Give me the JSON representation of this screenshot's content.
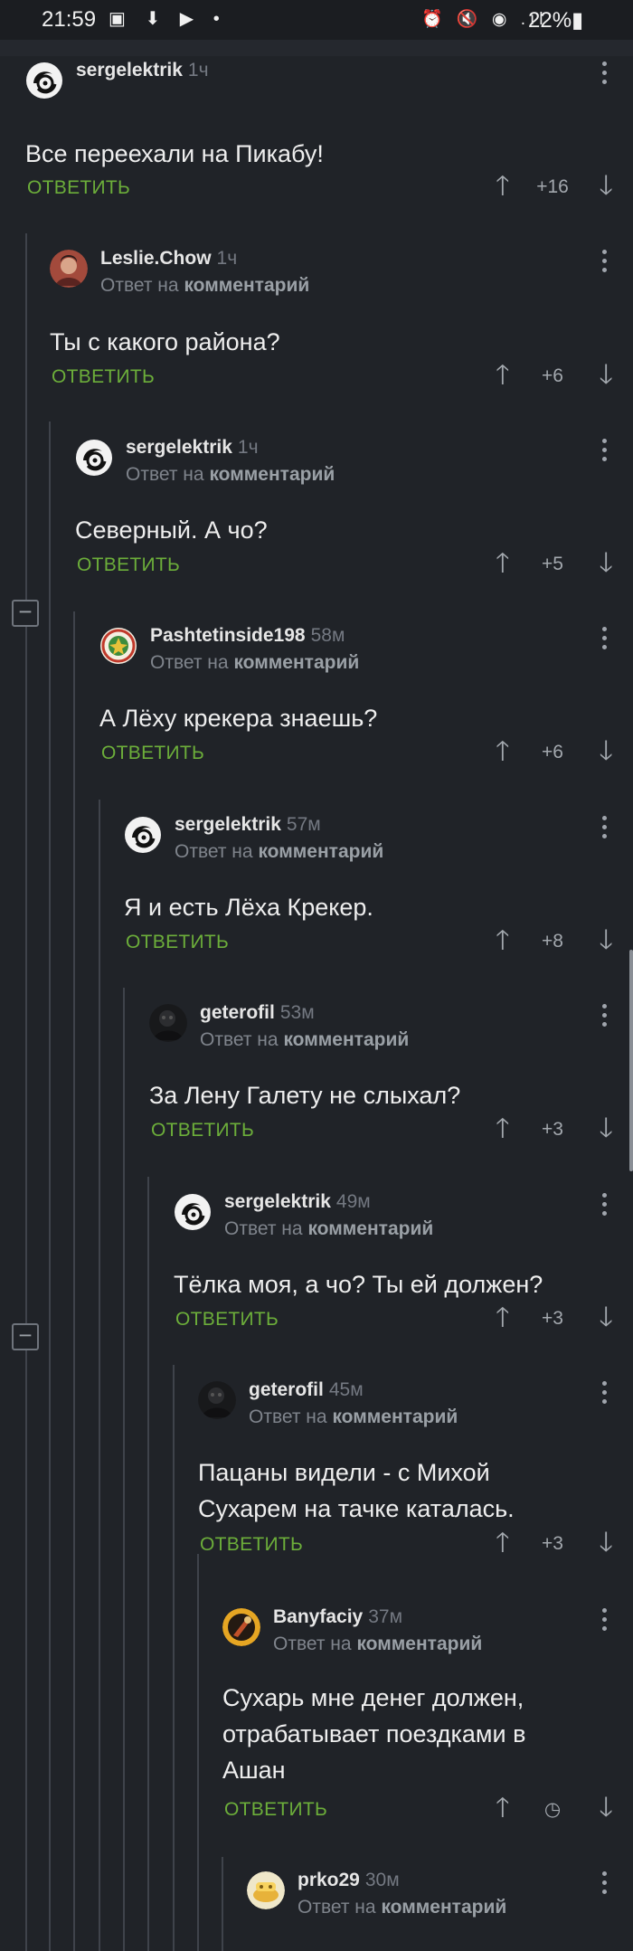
{
  "status_bar": {
    "time": "21:59",
    "left_icons": "▣ ⬇ ▶ •",
    "right_icons": "⏰ 🔇 ◉ .ıl",
    "battery": "22%▮"
  },
  "comments": [
    {
      "author": "sergelektrik",
      "time": "1ч",
      "reply_prefix": "",
      "reply_target": "",
      "text": "Все переехали на Пикабу!",
      "reply_label": "ОТВЕТИТЬ",
      "score": "+16",
      "avatar": "logo"
    },
    {
      "author": "Leslie.Chow",
      "time": "1ч",
      "reply_prefix": "Ответ на",
      "reply_target": "комментарий",
      "text": "Ты с какого района?",
      "reply_label": "ОТВЕТИТЬ",
      "score": "+6",
      "avatar": "photo-red"
    },
    {
      "author": "sergelektrik",
      "time": "1ч",
      "reply_prefix": "Ответ на",
      "reply_target": "комментарий",
      "text": "Северный. А чо?",
      "reply_label": "ОТВЕТИТЬ",
      "score": "+5",
      "avatar": "logo"
    },
    {
      "author": "Pashtetinside198",
      "time": "58м",
      "reply_prefix": "Ответ на",
      "reply_target": "комментарий",
      "text": "А Лёху крекера знаешь?",
      "reply_label": "ОТВЕТИТЬ",
      "score": "+6",
      "avatar": "emblem"
    },
    {
      "author": "sergelektrik",
      "time": "57м",
      "reply_prefix": "Ответ на",
      "reply_target": "комментарий",
      "text": "Я и есть Лёха Крекер.",
      "reply_label": "ОТВЕТИТЬ",
      "score": "+8",
      "avatar": "logo"
    },
    {
      "author": "geterofil",
      "time": "53м",
      "reply_prefix": "Ответ на",
      "reply_target": "комментарий",
      "text": "За Лену Галету не слыхал?",
      "reply_label": "ОТВЕТИТЬ",
      "score": "+3",
      "avatar": "photo-dark"
    },
    {
      "author": "sergelektrik",
      "time": "49м",
      "reply_prefix": "Ответ на",
      "reply_target": "комментарий",
      "text": "Тёлка моя, а чо? Ты ей должен?",
      "reply_label": "ОТВЕТИТЬ",
      "score": "+3",
      "avatar": "logo"
    },
    {
      "author": "geterofil",
      "time": "45м",
      "reply_prefix": "Ответ на",
      "reply_target": "комментарий",
      "text": "Пацаны видели - с Михой\nСухарем на тачке каталась.",
      "reply_label": "ОТВЕТИТЬ",
      "score": "+3",
      "avatar": "photo-dark"
    },
    {
      "author": "Banyfaciy",
      "time": "37м",
      "reply_prefix": "Ответ на",
      "reply_target": "комментарий",
      "text": "Сухарь мне денег должен,\nотрабатывает поездками в\nАшан",
      "reply_label": "ОТВЕТИТЬ",
      "score": "",
      "avatar": "photo-orange"
    },
    {
      "author": "prko29",
      "time": "30м",
      "reply_prefix": "Ответ на",
      "reply_target": "комментарий",
      "text": "",
      "reply_label": "",
      "score": "",
      "avatar": "photo-yellow"
    }
  ],
  "icons": {
    "upvote": "arrow-up-icon",
    "downvote": "arrow-down-icon",
    "pending": "clock-icon",
    "menu": "more-vertical-icon",
    "collapse": "collapse-minus-icon"
  },
  "colors": {
    "background": "#202328",
    "reply_accent": "#6cae3a",
    "muted": "#7f848c"
  }
}
